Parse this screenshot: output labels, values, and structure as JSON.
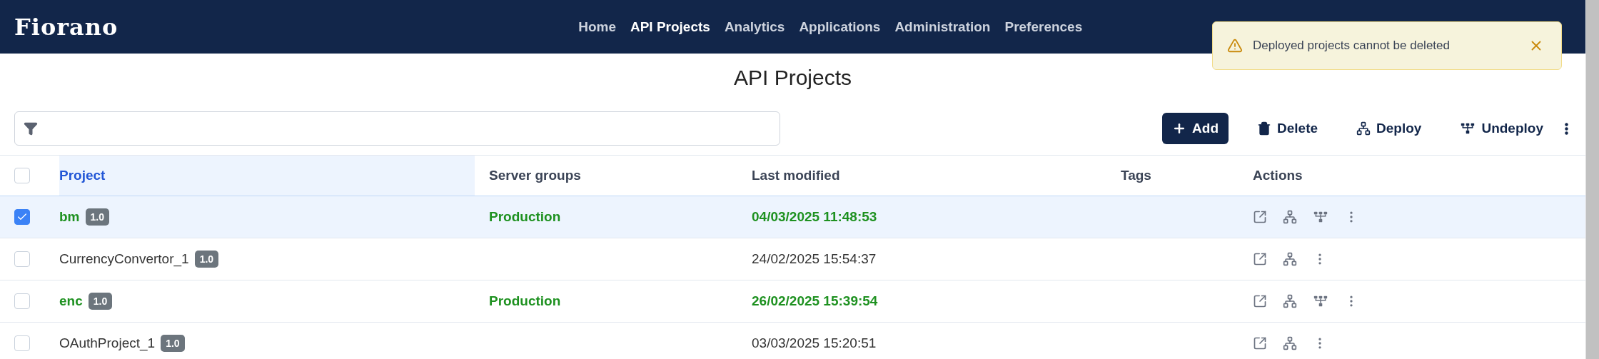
{
  "nav": {
    "logo": "Fiorano",
    "items": [
      {
        "label": "Home",
        "selected": false
      },
      {
        "label": "API Projects",
        "selected": true
      },
      {
        "label": "Analytics",
        "selected": false
      },
      {
        "label": "Applications",
        "selected": false
      },
      {
        "label": "Administration",
        "selected": false
      },
      {
        "label": "Preferences",
        "selected": false
      }
    ]
  },
  "toast": {
    "kind": "warning",
    "message": "Deployed projects cannot be deleted"
  },
  "page_title": "API Projects",
  "toolbar": [
    {
      "kind": "add",
      "label": "Add"
    },
    {
      "kind": "delete",
      "label": "Delete"
    },
    {
      "kind": "deploy",
      "label": "Deploy"
    },
    {
      "kind": "undeploy",
      "label": "Undeploy"
    }
  ],
  "table": {
    "all_checked": false,
    "columns": [
      {
        "label": "Project",
        "sorted": true
      },
      {
        "label": "Server groups",
        "sorted": false
      },
      {
        "label": "Last modified",
        "sorted": false
      },
      {
        "label": "Tags",
        "sorted": false
      },
      {
        "label": "Actions",
        "sorted": false
      }
    ],
    "rows": [
      {
        "selected": true,
        "deployed": true,
        "project": "bm",
        "version": "1.0",
        "server_groups": "Production",
        "last_modified": "04/03/2025 11:48:53"
      },
      {
        "selected": false,
        "deployed": false,
        "project": "CurrencyConvertor_1",
        "version": "1.0",
        "server_groups": "",
        "last_modified": "24/02/2025 15:54:37"
      },
      {
        "selected": false,
        "deployed": true,
        "project": "enc",
        "version": "1.0",
        "server_groups": "Production",
        "last_modified": "26/02/2025 15:39:54"
      },
      {
        "selected": false,
        "deployed": false,
        "project": "OAuthProject_1",
        "version": "1.0",
        "server_groups": "",
        "last_modified": "03/03/2025 15:20:51"
      }
    ]
  }
}
